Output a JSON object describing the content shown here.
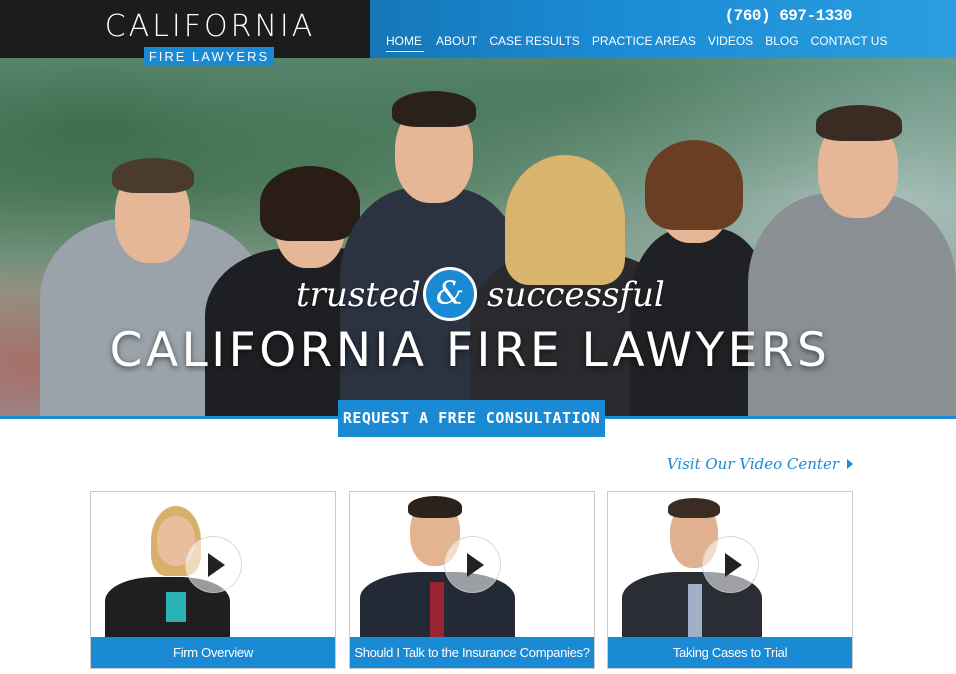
{
  "header": {
    "logo_title": "CALIFORNIA",
    "logo_subtitle": "FIRE LAWYERS",
    "phone": "(760) 697-1330",
    "nav": [
      "HOME",
      "ABOUT",
      "CASE RESULTS",
      "PRACTICE AREAS",
      "VIDEOS",
      "BLOG",
      "CONTACT US"
    ]
  },
  "hero": {
    "tag_left": "trusted",
    "tag_amp": "&",
    "tag_right": "successful",
    "title": "CALIFORNIA FIRE LAWYERS",
    "cta": "REQUEST A FREE CONSULTATION"
  },
  "videos": {
    "link": "Visit Our Video Center",
    "cards": [
      {
        "caption": "Firm Overview"
      },
      {
        "caption": "Should I Talk to the Insurance Companies?"
      },
      {
        "caption": "Taking Cases to Trial"
      }
    ]
  },
  "colors": {
    "accent": "#1a8ad4",
    "dark": "#1c1c1c"
  }
}
